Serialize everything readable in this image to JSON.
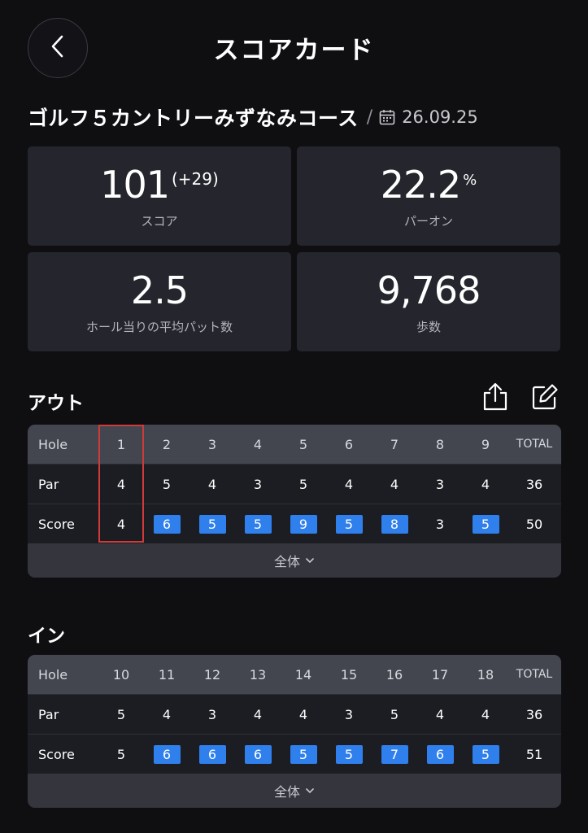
{
  "header": {
    "title": "スコアカード",
    "back_icon": "chevron-left-icon"
  },
  "course": {
    "name": "ゴルフ５カントリーみずなみコース",
    "separator": "/",
    "date": "26.09.25",
    "date_icon": "calendar-icon"
  },
  "stats": [
    {
      "value": "101",
      "sub": "(+29)",
      "unit": "",
      "label": "スコア"
    },
    {
      "value": "22.2",
      "sub": "",
      "unit": "%",
      "label": "パーオン"
    },
    {
      "value": "2.5",
      "sub": "",
      "unit": "",
      "label": "ホール当りの平均パット数"
    },
    {
      "value": "9,768",
      "sub": "",
      "unit": "",
      "label": "歩数"
    }
  ],
  "toolbar": {
    "share_icon": "share-icon",
    "edit_icon": "edit-icon"
  },
  "out": {
    "title": "アウト",
    "row_labels": {
      "hole": "Hole",
      "par": "Par",
      "score": "Score"
    },
    "holes": [
      "1",
      "2",
      "3",
      "4",
      "5",
      "6",
      "7",
      "8",
      "9"
    ],
    "total_label": "TOTAL",
    "par": [
      "4",
      "5",
      "4",
      "3",
      "5",
      "4",
      "4",
      "3",
      "4"
    ],
    "par_total": "36",
    "score": [
      "4",
      "6",
      "5",
      "5",
      "9",
      "5",
      "8",
      "3",
      "5"
    ],
    "score_highlighted": [
      false,
      true,
      true,
      true,
      true,
      true,
      true,
      false,
      true
    ],
    "score_total": "50",
    "expand_label": "全体"
  },
  "in": {
    "title": "イン",
    "row_labels": {
      "hole": "Hole",
      "par": "Par",
      "score": "Score"
    },
    "holes": [
      "10",
      "11",
      "12",
      "13",
      "14",
      "15",
      "16",
      "17",
      "18"
    ],
    "total_label": "TOTAL",
    "par": [
      "5",
      "4",
      "3",
      "4",
      "4",
      "3",
      "5",
      "4",
      "4"
    ],
    "par_total": "36",
    "score": [
      "5",
      "6",
      "6",
      "6",
      "5",
      "5",
      "7",
      "6",
      "5"
    ],
    "score_highlighted": [
      false,
      true,
      true,
      true,
      true,
      true,
      true,
      true,
      true
    ],
    "score_total": "51",
    "expand_label": "全体"
  },
  "colors": {
    "background": "#0f0f12",
    "card": "#24252d",
    "badge": "#2f80ec",
    "highlight": "#d03a3a"
  }
}
